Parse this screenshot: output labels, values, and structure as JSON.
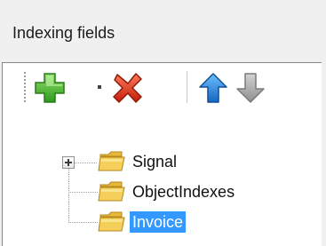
{
  "panel": {
    "title": "Indexing fields"
  },
  "toolbar": {
    "buttons": [
      {
        "name": "add",
        "icon": "plus-icon",
        "color": "#3fae29"
      },
      {
        "name": "delete",
        "icon": "delete-x-icon",
        "color": "#e03a1e"
      },
      {
        "name": "move-up",
        "icon": "arrow-up-icon",
        "color": "#2f8fe0"
      },
      {
        "name": "move-down",
        "icon": "arrow-down-icon",
        "color": "#a8a8a8"
      }
    ]
  },
  "tree": {
    "items": [
      {
        "label": "Signal",
        "expandable": true,
        "selected": false,
        "icon": "folder-icon"
      },
      {
        "label": "ObjectIndexes",
        "expandable": false,
        "selected": false,
        "icon": "folder-icon"
      },
      {
        "label": "Invoice",
        "expandable": false,
        "selected": true,
        "icon": "folder-icon"
      }
    ]
  },
  "colors": {
    "selection": "#3399ff",
    "folder": "#f2c94c"
  }
}
